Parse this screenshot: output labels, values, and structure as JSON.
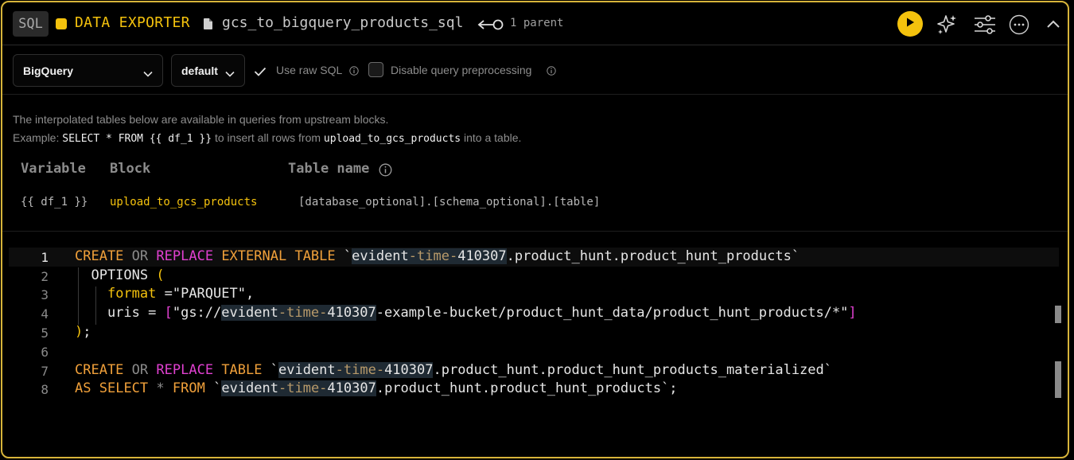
{
  "header": {
    "language_badge": "SQL",
    "block_type": "DATA EXPORTER",
    "block_name": "gcs_to_bigquery_products_sql",
    "parent_label": "1 parent",
    "colors": {
      "accent": "#f4c20d",
      "border": "#d7b43a"
    },
    "icons": [
      "file-icon",
      "parent-link-icon",
      "play-icon",
      "sparkles-icon",
      "sliders-icon",
      "more-icon",
      "chevron-up-icon"
    ]
  },
  "toolbar": {
    "connection_select": "BigQuery",
    "profile_select": "default",
    "use_raw_sql_label": "Use raw SQL",
    "use_raw_sql_checked": true,
    "disable_preprocessing_label": "Disable query preprocessing",
    "disable_preprocessing_checked": false
  },
  "info": {
    "line1": "The interpolated tables below are available in queries from upstream blocks.",
    "line2_prefix": "Example: ",
    "line2_code": "SELECT * FROM {{ df_1 }}",
    "line2_mid": " to insert all rows from ",
    "line2_block": "upload_to_gcs_products",
    "line2_suffix": " into a table.",
    "table": {
      "headers": {
        "variable": "Variable",
        "block": "Block",
        "table_name": "Table name"
      },
      "rows": [
        {
          "variable": "{{ df_1 }}",
          "block": "upload_to_gcs_products",
          "table_name": "[database_optional].[schema_optional].[table]"
        }
      ]
    }
  },
  "editor": {
    "line_numbers": [
      "1",
      "2",
      "3",
      "4",
      "5",
      "6",
      "7",
      "8"
    ],
    "active_line": 1,
    "lines": [
      "CREATE OR REPLACE EXTERNAL TABLE `evident-time-410307.product_hunt.product_hunt_products`",
      "  OPTIONS (",
      "    format =\"PARQUET\",",
      "    uris = [\"gs://evident-time-410307-example-bucket/product_hunt_data/product_hunt_products/*\"]",
      ");",
      "",
      "CREATE OR REPLACE TABLE `evident-time-410307.product_hunt.product_hunt_products_materialized`",
      "AS SELECT * FROM `evident-time-410307.product_hunt.product_hunt_products`;"
    ]
  }
}
